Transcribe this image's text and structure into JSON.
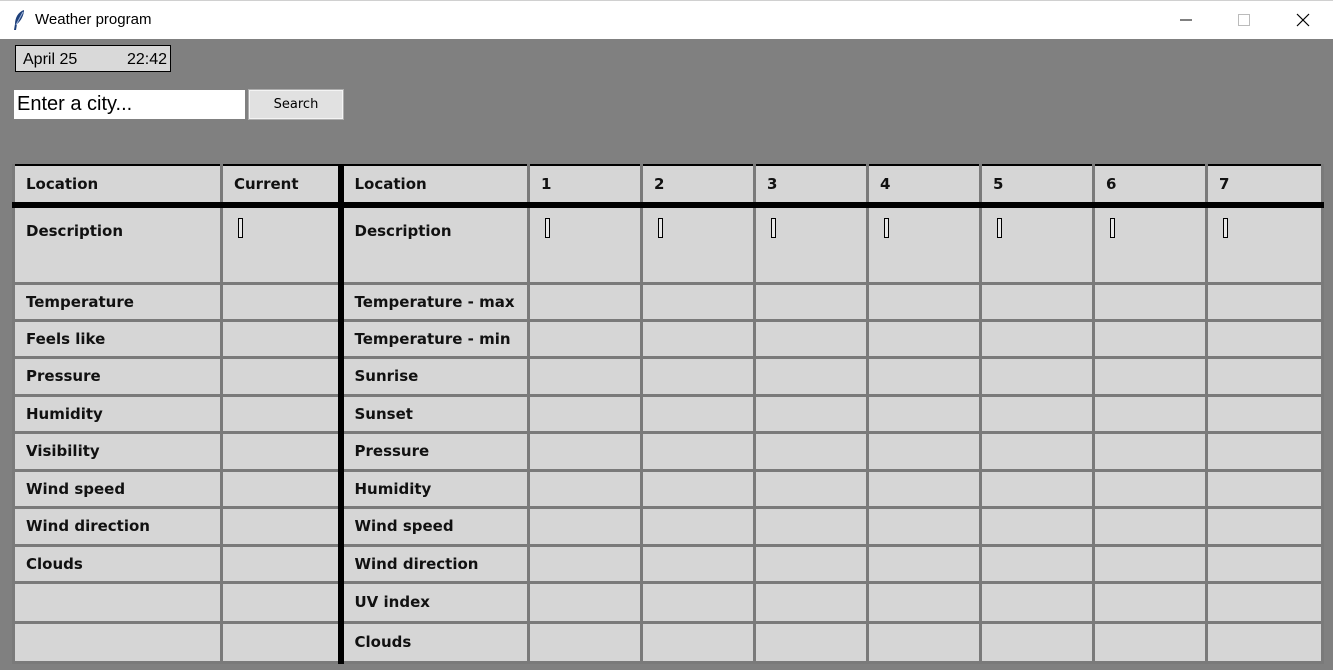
{
  "window": {
    "title": "Weather program"
  },
  "info": {
    "date": "April 25",
    "time": "22:42"
  },
  "search": {
    "placeholder": "Enter a city...",
    "button": "Search"
  },
  "current": {
    "header": [
      "Location",
      "Current"
    ],
    "rows": [
      "Description",
      "Temperature",
      "Feels like",
      "Pressure",
      "Humidity",
      "Visibility",
      "Wind speed",
      "Wind direction",
      "Clouds",
      "",
      ""
    ]
  },
  "forecast": {
    "header": [
      "Location",
      "1",
      "2",
      "3",
      "4",
      "5",
      "6",
      "7"
    ],
    "rows": [
      "Description",
      "Temperature - max",
      "Temperature - min",
      "Sunrise",
      "Sunset",
      "Pressure",
      "Humidity",
      "Wind speed",
      "Wind direction",
      "UV index",
      "Clouds"
    ]
  }
}
